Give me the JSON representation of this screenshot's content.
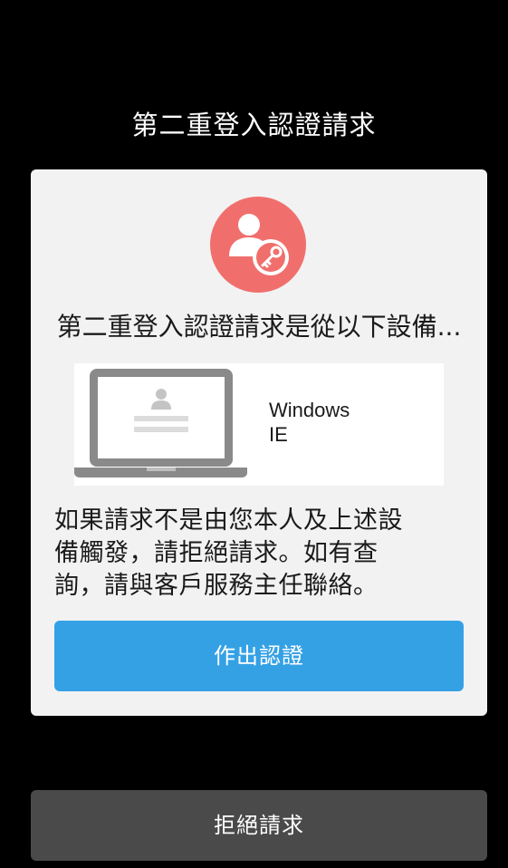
{
  "header": {
    "title": "第二重登入認證請求"
  },
  "card": {
    "icon": "user-key-icon",
    "subtitle": "第二重登入認證請求是從以下設備...",
    "device": {
      "icon": "laptop-icon",
      "os": "Windows",
      "browser": "IE"
    },
    "body_lines": [
      "如果請求不是由您本人及上述設",
      "備觸發，請拒絕請求。如有查",
      "詢，請與客戶服務主任聯絡。"
    ],
    "confirm_label": "作出認證"
  },
  "footer": {
    "reject_label": "拒絕請求"
  },
  "colors": {
    "background": "#000000",
    "card": "#f2f2f2",
    "avatar": "#f06f6d",
    "confirm": "#35a1e5",
    "reject": "#4a4a4a"
  }
}
